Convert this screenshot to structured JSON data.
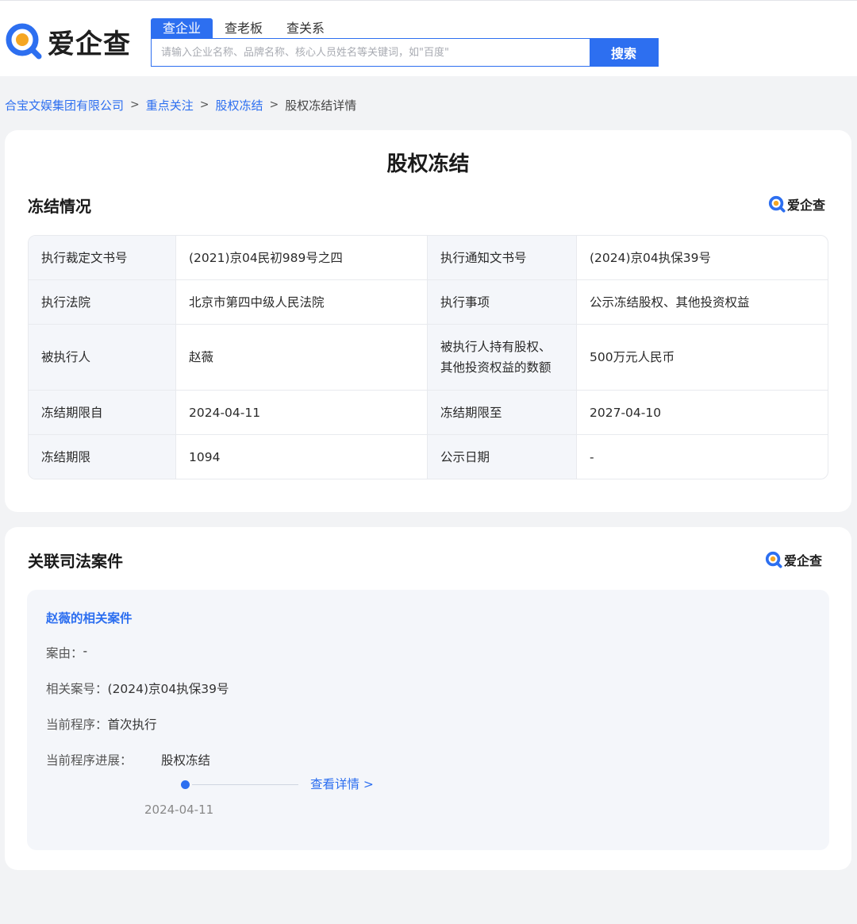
{
  "header": {
    "logo_text": "爱企查",
    "tabs": [
      "查企业",
      "查老板",
      "查关系"
    ],
    "search_placeholder": "请输入企业名称、品牌名称、核心人员姓名等关键词，如\"百度\"",
    "search_button": "搜索"
  },
  "breadcrumb": {
    "items": [
      "合宝文娱集团有限公司",
      "重点关注",
      "股权冻结"
    ],
    "current": "股权冻结详情",
    "separator": ">"
  },
  "freeze": {
    "page_title": "股权冻结",
    "section_title": "冻结情况",
    "brand_label": "爱企查",
    "rows": [
      [
        "执行裁定文书号",
        "(2021)京04民初989号之四",
        "执行通知文书号",
        "(2024)京04执保39号"
      ],
      [
        "执行法院",
        "北京市第四中级人民法院",
        "执行事项",
        "公示冻结股权、其他投资权益"
      ],
      [
        "被执行人",
        "赵薇",
        "被执行人持有股权、其他投资权益的数额",
        "500万元人民币"
      ],
      [
        "冻结期限自",
        "2024-04-11",
        "冻结期限至",
        "2027-04-10"
      ],
      [
        "冻结期限",
        "1094",
        "公示日期",
        "-"
      ]
    ],
    "label_wrap": {
      "row3_col3_line1": "被执行人持有股权、",
      "row3_col3_line2": "其他投资权益的数额"
    }
  },
  "related": {
    "section_title": "关联司法案件",
    "brand_label": "爱企查",
    "case_link": "赵薇的相关案件",
    "cause_label": "案由：",
    "cause_value": "-",
    "case_no_label": "相关案号：",
    "case_no_value": "(2024)京04执保39号",
    "stage_label": "当前程序：",
    "stage_value": "首次执行",
    "progress_label": "当前程序进展：",
    "progress_stage": "股权冻结",
    "detail_link": "查看详情 >",
    "progress_date": "2024-04-11"
  },
  "colors": {
    "accent": "#2d6ff0",
    "logo_blue": "#2d6ff0",
    "logo_orange": "#f5a623"
  }
}
